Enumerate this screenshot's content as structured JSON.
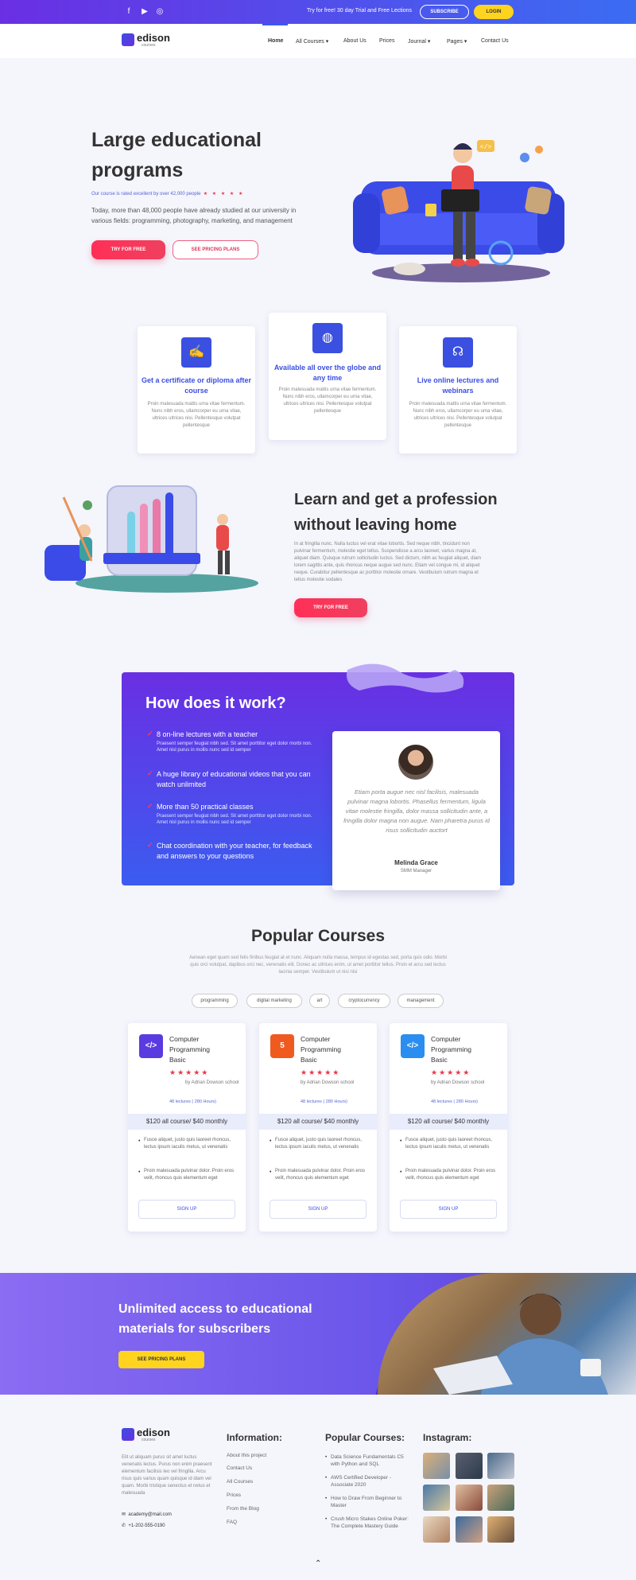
{
  "topbar": {
    "social": [
      "facebook-icon",
      "youtube-icon",
      "instagram-icon"
    ],
    "trial_text": "Try for free! 30 day Trial and Free Lections",
    "subscribe_label": "SUBSCRIBE",
    "login_label": "LOGIN"
  },
  "brand": {
    "name": "edison",
    "sub": "courses"
  },
  "nav": {
    "items": [
      "Home",
      "All Courses",
      "About Us",
      "Prices",
      "Journal",
      "Pages",
      "Contact Us"
    ]
  },
  "hero": {
    "title": "Large educational programs",
    "rating_text": "Our course is rated excellent by over 42,000 people",
    "stars": "★ ★ ★ ★ ★",
    "description": "Today, more than 48,000 people have already studied at our university in various fields: programming, photography, marketing, and management",
    "try_label": "TRY FOR FREE",
    "plans_label": "SEE PRICING PLANS",
    "code_badge": "</>"
  },
  "features": [
    {
      "icon": "certificate-icon",
      "title": "Get a certificate or diploma after course",
      "text": "Proin malesuada mattis urna vitae fermentum. Nunc nibh eros, ullamcorper eu urna vitae, ultrices ultrices nisi. Pellentesque volutpat pellentesque"
    },
    {
      "icon": "globe-icon",
      "title": "Available all over the globe and any time",
      "text": "Proin malesuada mattis urna vitae fermentum. Nunc nibh eros, ullamcorper eu urna vitae, ultrices ultrices nisi. Pellentesque volutpat pellentesque"
    },
    {
      "icon": "headset-icon",
      "title": "Live online lectures and webinars",
      "text": "Proin malesuada mattis urna vitae fermentum. Nunc nibh eros, ullamcorper eu urna vitae, ultrices ultrices nisi. Pellentesque volutpat pellentesque"
    }
  ],
  "learn": {
    "title": "Learn and get a profession without leaving home",
    "text": "In at fringilla nunc. Nulla luctus vel erat vitae lobortis. Sed neque nibh, tincidunt non pulvinar fermentum, molestie eget tellus. Suspendisse a arcu laoreet, varius magna at, aliquet diam. Quisque rutrum sollicitudin luctus. Sed dictum, nibh ac feugiat aliquet, diam lorem sagittis ante, quis rhoncus neque augue sed nunc. Etiam vel congue mi, id aliquet neque. Curabitur pellentesque ac porttitor molestie ornare. Vestibulum rutrum magna et tellus molestie sodales",
    "try_label": "TRY FOR FREE"
  },
  "how": {
    "title": "How does it work?",
    "items": [
      {
        "title": "8 on-line lectures with a teacher",
        "desc": "Praesent semper feugiat nibh sed. Sit amet porttitor eget dolor morbi non. Amet nisl purus in mollis nunc sed id semper"
      },
      {
        "title": "A huge library of educational videos that you can watch unlimited",
        "desc": ""
      },
      {
        "title": "More than 50 practical classes",
        "desc": "Praesent semper feugiat nibh sed. Sit amet porttitor eget dolor morbi non. Amet nisl purus in mollis nunc sed id semper"
      },
      {
        "title": "Chat coordination with your teacher, for feedback and answers to your questions",
        "desc": ""
      }
    ],
    "mark": "✓",
    "testimonial": {
      "quote": "Etiam porta augue nec nisl facilisis, malesuada pulvinar magna lobortis. Phasellus fermentum, ligula vitae molestie fringilla, dolor massa sollicitudin ante, a fringilla dolor magna non augue. Nam pharetra purus id risus sollicitudin auctort",
      "name": "Melinda Grace",
      "role": "SMM Manager"
    }
  },
  "popular": {
    "title": "Popular Courses",
    "description": "Aenean eget quam sed felis finibus feugiat at et nunc. Aliquam nulla massa, tempus id egestas sed, porta quis odio. Morbi quis orci volutpat, dapibus orci nec, venenatis elit. Donec ac ultrices enim, ut amet porttitor tellus. Proin et arcu sed lectus lacinia semper. Vestibulum ut nisi nisi",
    "tags": [
      "programming",
      "digital marketing",
      "art",
      "cryptocurrency",
      "management"
    ],
    "courses": [
      {
        "icon": "</>",
        "color": "#5a3be0",
        "title": "Computer Programming Basic",
        "stars": "★★★★★",
        "by": "by Adrian Dowson school",
        "lectures": "48 lectures ( 280 Hours)",
        "price": "$120 all course/ $40 monthly",
        "b1": "Fusce aliquet, justo quis laoreet rhoncus, lectus ipsum iaculis metus, ut venenatis",
        "b2": "Proin malesuada pulvinar dolor. Proin eros velit, rhoncus quis elementum eget",
        "signup": "SIGN UP"
      },
      {
        "icon": "5",
        "color": "#f05a1e",
        "title": "Computer Programming Basic",
        "stars": "★★★★★",
        "by": "by Adrian Dowson school",
        "lectures": "48 lectures ( 280 Hours)",
        "price": "$120 all course/ $40 monthly",
        "b1": "Fusce aliquet, justo quis laoreet rhoncus, lectus ipsum iaculis metus, ut venenatis",
        "b2": "Proin malesuada pulvinar dolor. Proin eros velit, rhoncus quis elementum eget",
        "signup": "SIGN UP"
      },
      {
        "icon": "</>",
        "color": "#2a8ef0",
        "title": "Computer Programming Basic",
        "stars": "★★★★★",
        "by": "by Adrian Dowson school",
        "lectures": "48 lectures ( 280 Hours)",
        "price": "$120 all course/ $40 monthly",
        "b1": "Fusce aliquet, justo quis laoreet rhoncus, lectus ipsum iaculis metus, ut venenatis",
        "b2": "Proin malesuada pulvinar dolor. Proin eros velit, rhoncus quis elementum eget",
        "signup": "SIGN UP"
      }
    ]
  },
  "banner": {
    "title": "Unlimited access to educational materials for subscribers",
    "button_label": "SEE PRICING PLANS"
  },
  "footer": {
    "about": "Elit ut aliquam purus sit amet luctus venenatis lectus. Purus non enim praesent elementum facilisis leo vel fringilla. Arcu risus quis varius quam quisque id diam vel quam. Morbi tristique senectus et netus et malesuada",
    "email": "academy@mail.com",
    "phone": "+1-202-555-0190",
    "info_title": "Information:",
    "info_links": [
      "About this project",
      "Contact Us",
      "All Courses",
      "Prices",
      "From the Blog",
      "FAQ"
    ],
    "courses_title": "Popular Courses:",
    "courses": [
      "Data Science Fundamentals C5 with Python and SQL",
      "AWS Certified Developer - Associate 2020",
      "How to Draw From Beginner to Master",
      "Crush Micro Stakes Online Poker: The Complete Mastery Guide"
    ],
    "insta_title": "Instagram:",
    "up_arrow": "⌃"
  }
}
